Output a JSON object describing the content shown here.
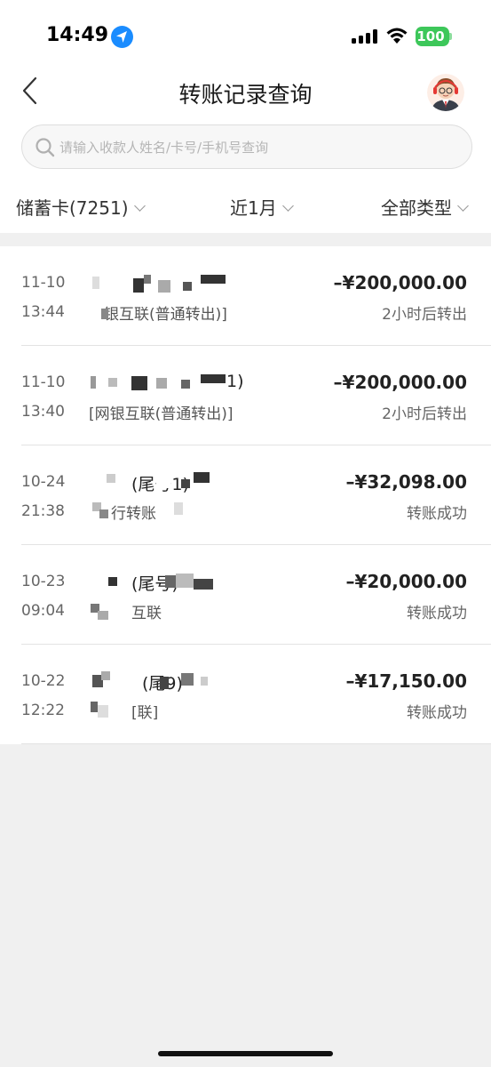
{
  "status_bar": {
    "time": "14:49",
    "battery": "100",
    "icons": [
      "location-arrow-icon",
      "signal-icon",
      "wifi-icon",
      "battery-icon"
    ]
  },
  "nav": {
    "title": "转账记录查询",
    "back_icon": "chevron-left-icon",
    "avatar_icon": "avatar-icon"
  },
  "search": {
    "placeholder": "请输入收款人姓名/卡号/手机号查询",
    "icon": "search-icon"
  },
  "filters": {
    "card": "储蓄卡(7251)",
    "period": "近1月",
    "type": "全部类型"
  },
  "records": [
    {
      "date": "11-10",
      "time": "13:44",
      "name": "",
      "desc": "银互联(普通转出)]",
      "amount": "–¥200,000.00",
      "status": "2小时后转出"
    },
    {
      "date": "11-10",
      "time": "13:40",
      "name": "1)",
      "desc": "[网银互联(普通转出)]",
      "amount": "–¥200,000.00",
      "status": "2小时后转出"
    },
    {
      "date": "10-24",
      "time": "21:38",
      "name": "(尾号1)",
      "desc": "行转账",
      "amount": "–¥32,098.00",
      "status": "转账成功"
    },
    {
      "date": "10-23",
      "time": "09:04",
      "name": "(尾号)",
      "desc": "互联",
      "amount": "–¥20,000.00",
      "status": "转账成功"
    },
    {
      "date": "10-22",
      "time": "12:22",
      "name": "(尾9)",
      "desc": "[联]",
      "amount": "–¥17,150.00",
      "status": "转账成功"
    }
  ],
  "colors": {
    "page_bg": "#f0f0f0",
    "accent_blue": "#1a8cff",
    "battery_green": "#3dc75a"
  }
}
